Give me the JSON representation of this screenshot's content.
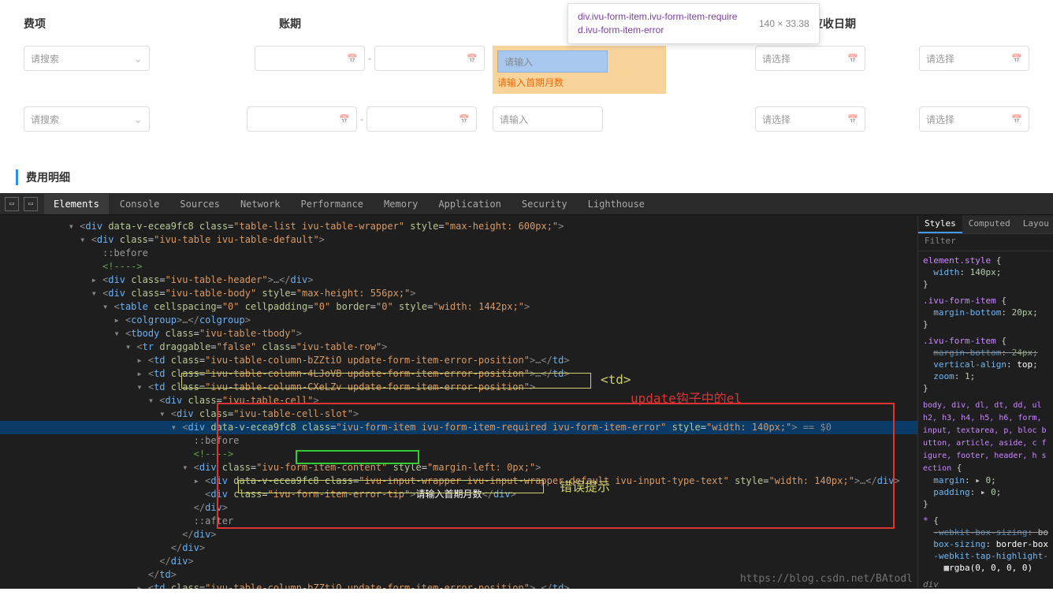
{
  "form": {
    "headers": [
      "费项",
      "账期",
      "",
      "首期应收日期"
    ],
    "tooltip": {
      "selector": "div.ivu-form-item.ivu-form-item-required.ivu-form-item-error",
      "dimensions": "140 × 33.38"
    },
    "search_placeholder": "请搜索",
    "input_placeholder": "请输入",
    "select_placeholder": "请选择",
    "error_tip": "请输入首期月数",
    "section_title": "费用明细"
  },
  "devtools": {
    "tabs": [
      "Elements",
      "Console",
      "Sources",
      "Network",
      "Performance",
      "Memory",
      "Application",
      "Security",
      "Lighthouse"
    ],
    "active_tab": "Elements",
    "styles_tabs": [
      "Styles",
      "Computed",
      "Layou"
    ],
    "filter_placeholder": "Filter",
    "styles": {
      "element_style": {
        "sel": "element.style",
        "rules": [
          [
            "width",
            "140px"
          ]
        ]
      },
      "form_item1": {
        "sel": ".ivu-form-item",
        "rules": [
          [
            "margin-bottom",
            "20px"
          ]
        ]
      },
      "form_item2": {
        "sel": ".ivu-form-item",
        "rules": [
          [
            "margin-bottom",
            "24px",
            true
          ],
          [
            "vertical-align",
            "top"
          ],
          [
            "zoom",
            "1"
          ]
        ]
      },
      "reset_sel": "body, div, dl, dt, dd, ul h2, h3, h4, h5, h6, form, input, textarea, p, bloc button, article, aside, c figure, footer, header, h section",
      "reset_rules": [
        [
          "margin",
          "▸ 0"
        ],
        [
          "padding",
          "▸ 0"
        ]
      ],
      "star_sel": "*",
      "star_rules": [
        [
          "-webkit-box-sizing",
          "bo",
          true
        ],
        [
          "box-sizing",
          "border-box"
        ],
        [
          "-webkit-tap-highlight-"
        ]
      ],
      "swatch": "rgba(0, 0, 0, 0)",
      "inherit": "div"
    },
    "dom": {
      "l1": {
        "attr": "data-v-ecea9fc8",
        "cls": "table-list ivu-table-wrapper",
        "style": "max-height: 600px;"
      },
      "l2": {
        "cls": "ivu-table ivu-table-default"
      },
      "before": "::before",
      "cmt": "<!---->",
      "header_cls": "ivu-table-header",
      "body": {
        "cls": "ivu-table-body",
        "style": "max-height: 556px;"
      },
      "table": {
        "cellspacing": "0",
        "cellpadding": "0",
        "border": "0",
        "style": "width: 1442px;"
      },
      "colgroup": "colgroup",
      "tbody_cls": "ivu-table-tbody",
      "tr": {
        "draggable": "false",
        "cls": "ivu-table-row"
      },
      "td1_cls": "ivu-table-column-bZZtiO update-form-item-error-position",
      "td2_cls": "ivu-table-column-4LJoVB update-form-item-error-position",
      "td3_cls": "ivu-table-column-CXeLZv update-form-item-error-position",
      "cell_cls": "ivu-table-cell",
      "slot_cls": "ivu-table-cell-slot",
      "formitem": {
        "attr": "data-v-ecea9fc8",
        "cls": "ivu-form-item ivu-form-item-required ivu-form-item-error",
        "style": "width: 140px;",
        "mark": " == $0"
      },
      "content": {
        "cls": "ivu-form-item-content",
        "style": "margin-left: 0px;"
      },
      "inputwrap": {
        "attr": "data-v-ecea9fc8",
        "cls": "ivu-input-wrapper ivu-input-wrapper-default ivu-input-type-text",
        "style": "width: 140px;"
      },
      "errtip_cls": "ivu-form-item-error-tip",
      "errtip_txt": "请输入首期月数",
      "after": "::after"
    },
    "annotations": {
      "td_label": "<td>",
      "red_label": "update钩子中的el",
      "yellow_label": "错误提示"
    },
    "watermark": "https://blog.csdn.net/BAtodl"
  }
}
